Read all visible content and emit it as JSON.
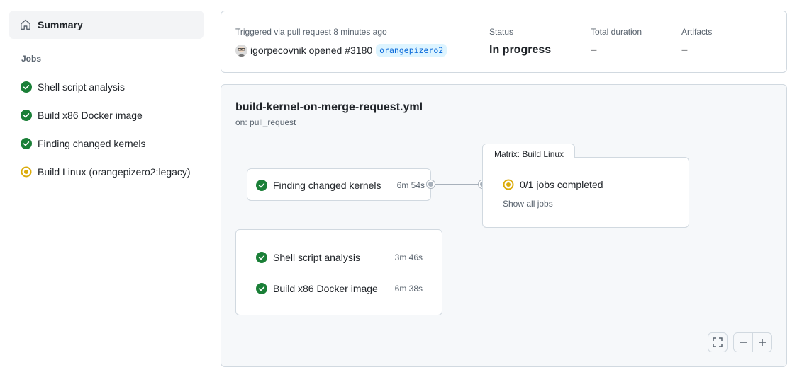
{
  "sidebar": {
    "summary_label": "Summary",
    "jobs_heading": "Jobs",
    "jobs": [
      {
        "label": "Shell script analysis",
        "status": "success"
      },
      {
        "label": "Build x86 Docker image",
        "status": "success"
      },
      {
        "label": "Finding changed kernels",
        "status": "success"
      },
      {
        "label": "Build Linux (orangepizero2:legacy)",
        "status": "in-progress"
      }
    ]
  },
  "trigger": {
    "label": "Triggered via pull request 8 minutes ago",
    "actor": "igorpecovnik",
    "action": "opened #3180",
    "branch": "orangepizero2",
    "status_label": "Status",
    "status_value": "In progress",
    "duration_label": "Total duration",
    "duration_value": "–",
    "artifacts_label": "Artifacts",
    "artifacts_value": "–"
  },
  "workflow": {
    "file": "build-kernel-on-merge-request.yml",
    "on": "on: pull_request",
    "finding_job": {
      "name": "Finding changed kernels",
      "duration": "6m 54s"
    },
    "matrix": {
      "title": "Matrix: Build Linux",
      "progress": "0/1 jobs completed",
      "show_all": "Show all jobs"
    },
    "group_jobs": [
      {
        "name": "Shell script analysis",
        "duration": "3m 46s"
      },
      {
        "name": "Build x86 Docker image",
        "duration": "6m 38s"
      }
    ]
  },
  "colors": {
    "success": "#1a7f37",
    "in_progress": "#dbab0a",
    "link": "#0969da"
  }
}
